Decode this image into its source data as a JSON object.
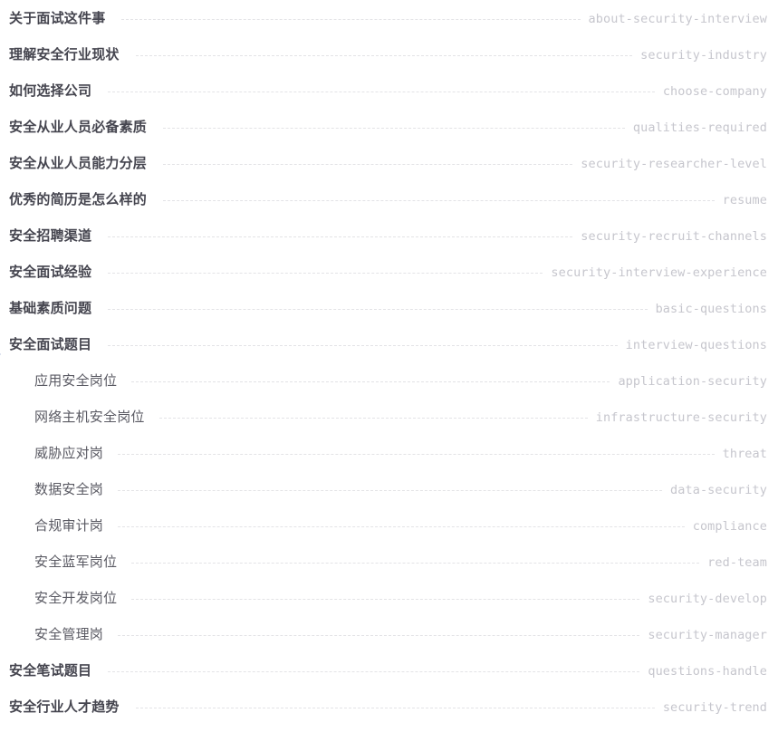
{
  "document": {
    "type": "table-of-contents",
    "background_color": "#ffffff",
    "label_color": "#45454f",
    "slug_color": "#c6c6cd",
    "leader_color": "#e3e3e6",
    "caret_color": "#7f93c4"
  },
  "entries": [
    {
      "label": "关于面试这件事",
      "slug": "about-security-interview",
      "level": 1,
      "caret": false
    },
    {
      "label": "理解安全行业现状",
      "slug": "security-industry",
      "level": 1,
      "caret": false
    },
    {
      "label": "如何选择公司",
      "slug": "choose-company",
      "level": 1,
      "caret": false
    },
    {
      "label": "安全从业人员必备素质",
      "slug": "qualities-required",
      "level": 1,
      "caret": false
    },
    {
      "label": "安全从业人员能力分层",
      "slug": "security-researcher-level",
      "level": 1,
      "caret": false
    },
    {
      "label": "优秀的简历是怎么样的",
      "slug": "resume",
      "level": 1,
      "caret": false
    },
    {
      "label": "安全招聘渠道",
      "slug": "security-recruit-channels",
      "level": 1,
      "caret": false
    },
    {
      "label": "安全面试经验",
      "slug": "security-interview-experience",
      "level": 1,
      "caret": false
    },
    {
      "label": "基础素质问题",
      "slug": "basic-questions",
      "level": 1,
      "caret": false
    },
    {
      "label": "安全面试题目",
      "slug": "interview-questions",
      "level": 1,
      "caret": true
    },
    {
      "label": "应用安全岗位",
      "slug": "application-security",
      "level": 2,
      "caret": false
    },
    {
      "label": "网络主机安全岗位",
      "slug": "infrastructure-security",
      "level": 2,
      "caret": false
    },
    {
      "label": "威胁应对岗",
      "slug": "threat",
      "level": 2,
      "caret": false
    },
    {
      "label": "数据安全岗",
      "slug": "data-security",
      "level": 2,
      "caret": false
    },
    {
      "label": "合规审计岗",
      "slug": "compliance",
      "level": 2,
      "caret": false
    },
    {
      "label": "安全蓝军岗位",
      "slug": "red-team",
      "level": 2,
      "caret": false
    },
    {
      "label": "安全开发岗位",
      "slug": "security-develop",
      "level": 2,
      "caret": false
    },
    {
      "label": "安全管理岗",
      "slug": "security-manager",
      "level": 2,
      "caret": false
    },
    {
      "label": "安全笔试题目",
      "slug": "questions-handle",
      "level": 1,
      "caret": false
    },
    {
      "label": "安全行业人才趋势",
      "slug": "security-trend",
      "level": 1,
      "caret": false
    }
  ]
}
